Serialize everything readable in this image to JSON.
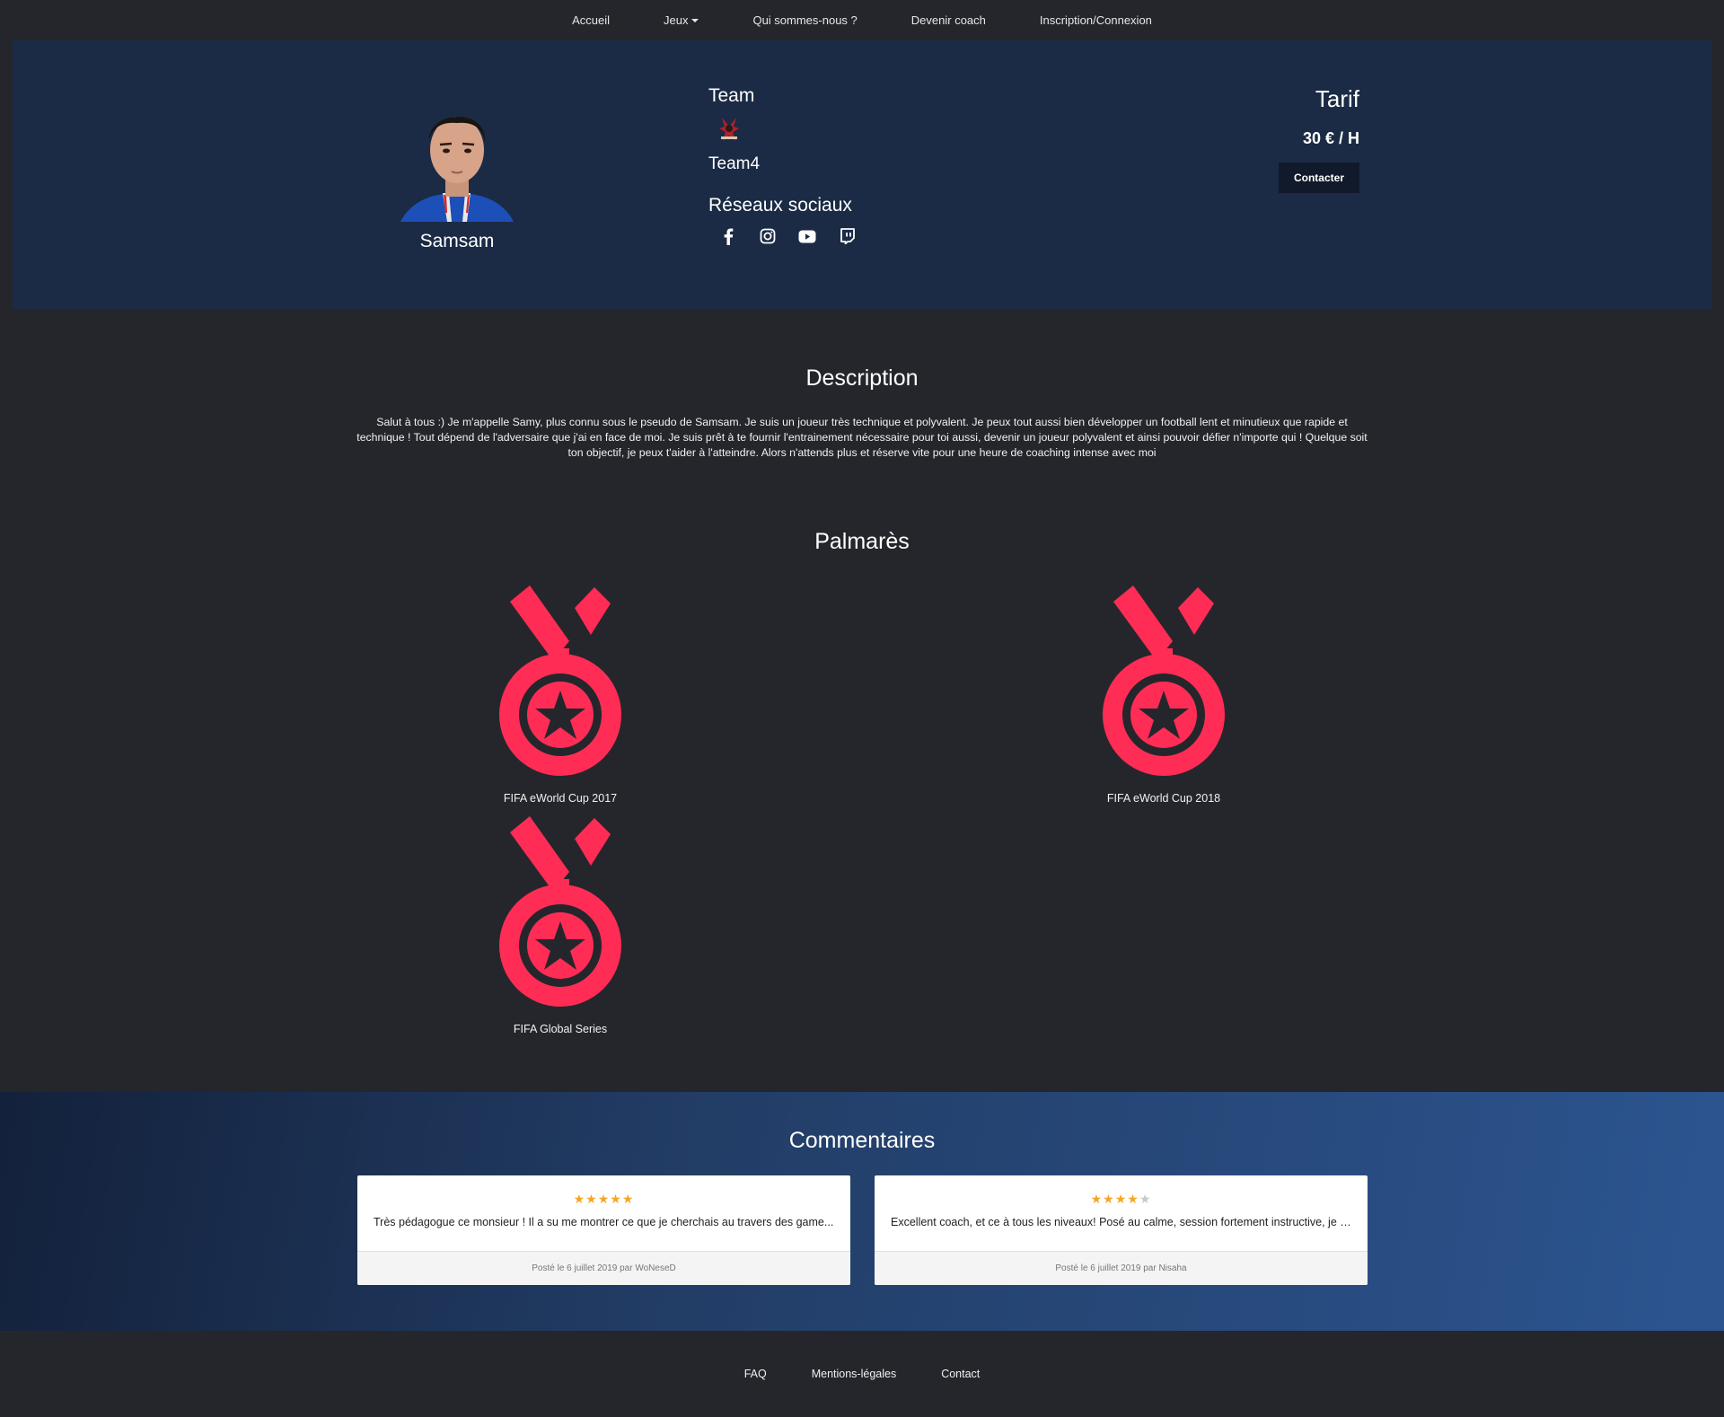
{
  "nav": {
    "items": [
      "Accueil",
      "Jeux",
      "Qui sommes-nous ?",
      "Devenir coach",
      "Inscription/Connexion"
    ]
  },
  "coach": {
    "name": "Samsam",
    "team_label": "Team",
    "team_name": "Team4",
    "social_label": "Réseaux sociaux",
    "social_icons": [
      "facebook-icon",
      "instagram-icon",
      "youtube-icon",
      "twitch-icon"
    ],
    "tarif_label": "Tarif",
    "price": "30 € / H",
    "contact_label": "Contacter"
  },
  "description": {
    "title": "Description",
    "text": "Salut à tous :) Je m'appelle Samy, plus connu sous le pseudo de Samsam. Je suis un joueur très technique et polyvalent. Je peux tout aussi bien développer un football lent et minutieux que rapide et technique ! Tout dépend de l'adversaire que j'ai en face de moi. Je suis prêt à te fournir l'entrainement nécessaire pour toi aussi, devenir un joueur polyvalent et ainsi pouvoir défier n'importe qui ! Quelque soit ton objectif, je peux t'aider à l'atteindre. Alors n'attends plus et réserve vite pour une heure de coaching intense avec moi"
  },
  "palmares": {
    "title": "Palmarès",
    "awards": [
      "FIFA eWorld Cup 2017",
      "FIFA eWorld Cup 2018",
      "FIFA Global Series"
    ],
    "medal_color": "#ff2d55"
  },
  "comments": {
    "title": "Commentaires",
    "items": [
      {
        "stars": 5,
        "text": "Très pédagogue ce monsieur ! Il a su me montrer ce que je cherchais au travers des game...",
        "footer": "Posté le 6 juillet 2019 par WoNeseD"
      },
      {
        "stars": 4,
        "text": "Excellent coach, et ce à tous les niveaux! Posé au calme, session fortement instructive, je l...",
        "footer": "Posté le 6 juillet 2019 par Nisaha"
      }
    ],
    "star_color": "#f5a623"
  },
  "footer": {
    "links": [
      "FAQ",
      "Mentions-légales",
      "Contact"
    ]
  }
}
